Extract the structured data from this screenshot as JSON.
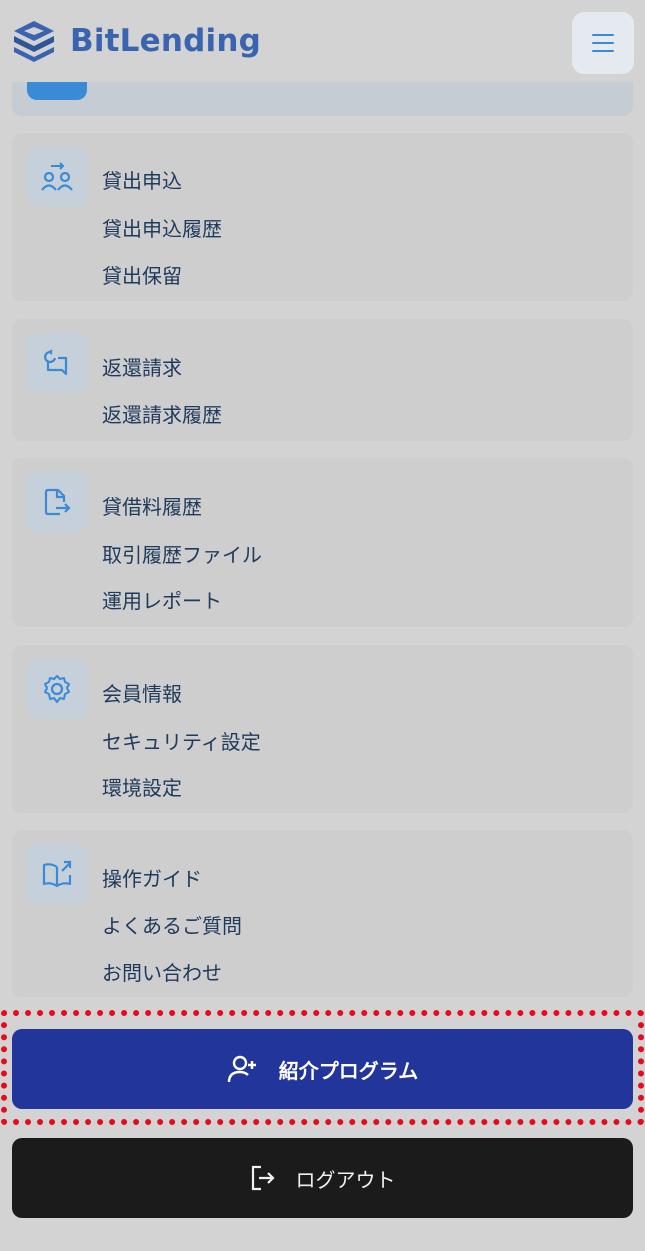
{
  "header": {
    "brand": "BitLending",
    "menu_icon": "hamburger-icon"
  },
  "groups": [
    {
      "icon": "people-exchange-icon",
      "items": [
        "貸出申込",
        "貸出申込履歴",
        "貸出保留"
      ]
    },
    {
      "icon": "return-arrow-icon",
      "items": [
        "返還請求",
        "返還請求履歴"
      ]
    },
    {
      "icon": "file-export-icon",
      "items": [
        "貸借料履歴",
        "取引履歴ファイル",
        "運用レポート"
      ]
    },
    {
      "icon": "gear-icon",
      "items": [
        "会員情報",
        "セキュリティ設定",
        "環境設定"
      ]
    },
    {
      "icon": "book-link-icon",
      "items": [
        "操作ガイド",
        "よくあるご質問",
        "お問い合わせ"
      ]
    }
  ],
  "buttons": {
    "referral": "紹介プログラム",
    "logout": "ログアウト"
  },
  "colors": {
    "brand_blue": "#3a64b0",
    "referral_bg": "#22359b",
    "logout_bg": "#1b1b1b",
    "highlight": "#e8091d"
  }
}
